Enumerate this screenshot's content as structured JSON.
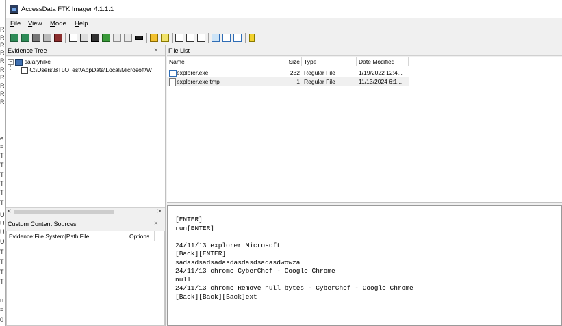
{
  "window": {
    "title": "AccessData FTK Imager 4.1.1.1"
  },
  "left_strip": {
    "chars": [
      "R",
      "R",
      "R",
      "R",
      "R",
      "R",
      "R",
      "R",
      "R",
      "R",
      "e",
      "=",
      "T",
      "T",
      "T",
      "T",
      "T",
      "T",
      "U",
      "U",
      "U",
      "U",
      "T",
      "T",
      "T",
      "T",
      "n",
      "=",
      "0"
    ]
  },
  "menu": {
    "items": [
      {
        "accel": "F",
        "rest": "ile"
      },
      {
        "accel": "V",
        "rest": "iew"
      },
      {
        "accel": "M",
        "rest": "ode"
      },
      {
        "accel": "H",
        "rest": "elp"
      }
    ]
  },
  "toolbar": {
    "icons": [
      "add-evidence-icon",
      "add-all-evidence-icon",
      "image-mounting-icon",
      "remove-evidence-icon",
      "remove-all-evidence-icon",
      "create-disk-image-icon",
      "export-disk-image-icon",
      "export-logical-image-icon",
      "add-to-custom-content-icon",
      "create-custom-content-image-icon",
      "decrypt-icon",
      "detect-efs-icon",
      "export-files-icon",
      "export-hash-list-icon",
      "verify-drive-icon",
      "capture-memory-icon",
      "obtain-protected-files-icon",
      "text-view-icon",
      "hex-view-icon",
      "auto-view-icon",
      "help-icon"
    ],
    "accent": "#2f6db5"
  },
  "evidence_tree": {
    "title": "Evidence Tree",
    "root": "salaryhike",
    "child": "C:\\Users\\BTLOTest\\AppData\\Local\\Microsoft\\W"
  },
  "file_list": {
    "title": "File List",
    "columns": [
      "Name",
      "Size",
      "Type",
      "Date Modified"
    ],
    "rows": [
      {
        "name": "explorer.exe",
        "size": "232",
        "type": "Regular File",
        "date": "1/19/2022 12:4..."
      },
      {
        "name": "explorer.exe.tmp",
        "size": "1",
        "type": "Regular File",
        "date": "11/13/2024 6:1..."
      }
    ]
  },
  "custom_content": {
    "title": "Custom Content Sources",
    "columns": [
      "Evidence:File System|Path|File",
      "Options"
    ]
  },
  "viewer": {
    "lines": [
      "[ENTER]",
      "run[ENTER]",
      "",
      "24/11/13 explorer Microsoft",
      "[Back][ENTER]",
      "sadasdsadsadasdasdasdsadasdwowza",
      "24/11/13 chrome CyberChef - Google Chrome",
      "null",
      "24/11/13 chrome Remove null bytes - CyberChef - Google Chrome",
      "[Back][Back][Back]ext"
    ]
  },
  "scroll": {
    "left": "<",
    "right": ">"
  },
  "close_glyph": "×"
}
